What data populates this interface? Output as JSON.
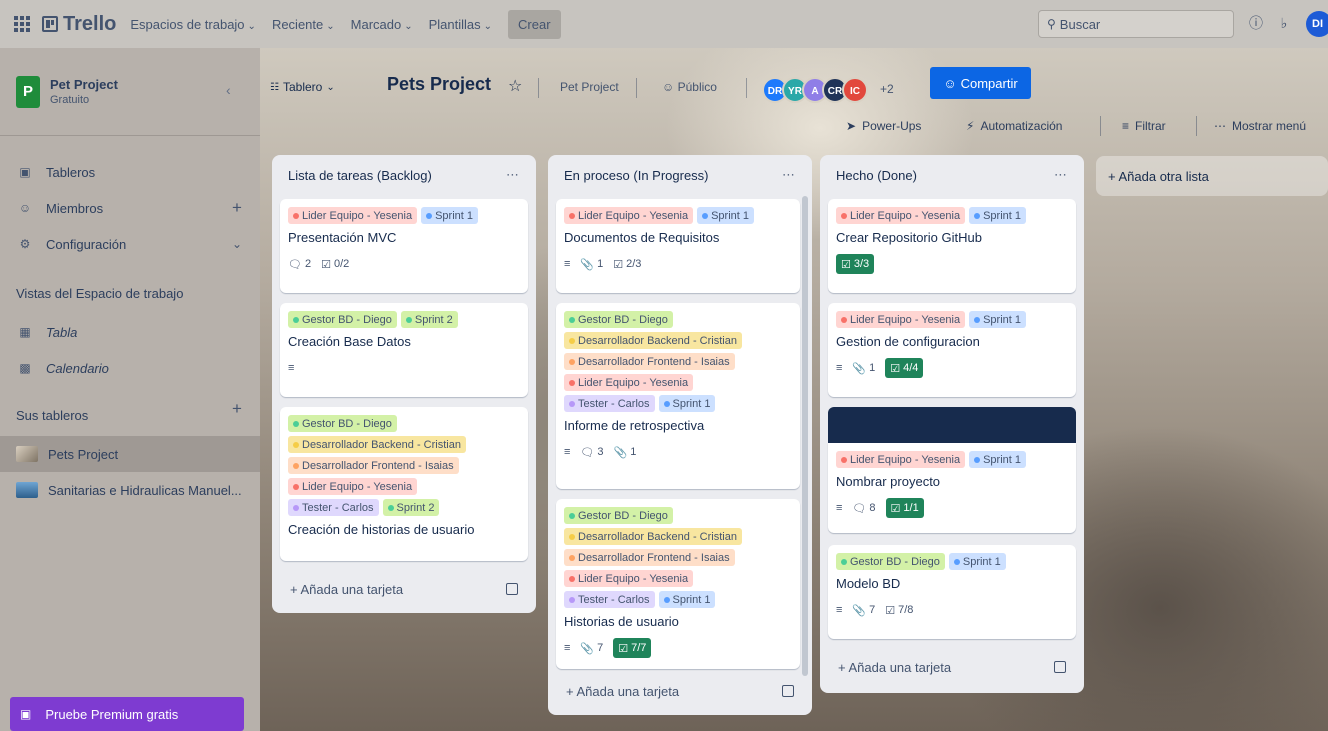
{
  "topbar": {
    "logo": "Trello",
    "nav": [
      {
        "label": "Espacios de trabajo"
      },
      {
        "label": "Reciente"
      },
      {
        "label": "Marcado"
      },
      {
        "label": "Plantillas"
      }
    ],
    "create_label": "Crear",
    "search_placeholder": "Buscar",
    "user_initials": "DI"
  },
  "sidebar": {
    "workspace_initial": "P",
    "workspace_name": "Pet Project",
    "workspace_plan": "Gratuito",
    "items": [
      {
        "label": "Tableros",
        "icon": "board-icon"
      },
      {
        "label": "Miembros",
        "icon": "person-icon"
      },
      {
        "label": "Configuración",
        "icon": "gear-icon"
      }
    ],
    "views_heading": "Vistas del Espacio de trabajo",
    "views": [
      {
        "label": "Tabla",
        "icon": "table-icon"
      },
      {
        "label": "Calendario",
        "icon": "calendar-icon"
      }
    ],
    "boards_heading": "Sus tableros",
    "boards": [
      {
        "label": "Pets Project"
      },
      {
        "label": "Sanitarias e Hidraulicas Manuel..."
      }
    ],
    "premium_label": "Pruebe Premium gratis"
  },
  "board": {
    "view_label": "Tablero",
    "title": "Pets Project",
    "workspace_label": "Pet Project",
    "visibility_label": "Público",
    "members": [
      "DR",
      "YR",
      "A",
      "CR",
      "IC"
    ],
    "members_more": "+2",
    "share_label": "Compartir",
    "powerups_label": "Power-Ups",
    "automation_label": "Automatización",
    "filter_label": "Filtrar",
    "menu_label": "Mostrar menú",
    "add_list_label": "+ Añada otra lista",
    "add_card_label": "+ Añada una tarjeta"
  },
  "lists": [
    {
      "title": "Lista de tareas (Backlog)",
      "cards": [
        {
          "labels": [
            {
              "text": "Lider Equipo - Yesenia",
              "color": "red"
            },
            {
              "text": "Sprint 1",
              "color": "blue"
            }
          ],
          "title": "Presentación MVC",
          "comments": "2",
          "checklist": "0/2"
        },
        {
          "labels": [
            {
              "text": "Gestor BD - Diego",
              "color": "green"
            },
            {
              "text": "Sprint 2",
              "color": "green"
            }
          ],
          "title": "Creación Base Datos"
        },
        {
          "labels": [
            {
              "text": "Gestor BD - Diego",
              "color": "green"
            },
            {
              "text": "Desarrollador Backend - Cristian",
              "color": "yellow"
            },
            {
              "text": "Desarrollador Frontend - Isaias",
              "color": "orange"
            },
            {
              "text": "Lider Equipo - Yesenia",
              "color": "red"
            },
            {
              "text": "Tester - Carlos",
              "color": "purple"
            },
            {
              "text": "Sprint 2",
              "color": "green"
            }
          ],
          "title": "Creación de historias de usuario"
        }
      ]
    },
    {
      "title": "En proceso (In Progress)",
      "cards": [
        {
          "labels": [
            {
              "text": "Lider Equipo - Yesenia",
              "color": "red"
            },
            {
              "text": "Sprint 1",
              "color": "blue"
            }
          ],
          "title": "Documentos de Requisitos",
          "attachments": "1",
          "checklist": "2/3"
        },
        {
          "labels": [
            {
              "text": "Gestor BD - Diego",
              "color": "green"
            },
            {
              "text": "Desarrollador Backend - Cristian",
              "color": "yellow"
            },
            {
              "text": "Desarrollador Frontend - Isaias",
              "color": "orange"
            },
            {
              "text": "Lider Equipo - Yesenia",
              "color": "red"
            },
            {
              "text": "Tester - Carlos",
              "color": "purple"
            },
            {
              "text": "Sprint 1",
              "color": "blue"
            }
          ],
          "title": "Informe de retrospectiva",
          "comments": "3",
          "attachments": "1"
        },
        {
          "labels": [
            {
              "text": "Gestor BD - Diego",
              "color": "green"
            },
            {
              "text": "Desarrollador Backend - Cristian",
              "color": "yellow"
            },
            {
              "text": "Desarrollador Frontend - Isaias",
              "color": "orange"
            },
            {
              "text": "Lider Equipo - Yesenia",
              "color": "red"
            },
            {
              "text": "Tester - Carlos",
              "color": "purple"
            },
            {
              "text": "Sprint 1",
              "color": "blue"
            }
          ],
          "title": "Historias de usuario",
          "attachments": "7",
          "checklist": "7/7"
        }
      ]
    },
    {
      "title": "Hecho (Done)",
      "cards": [
        {
          "labels": [
            {
              "text": "Lider Equipo - Yesenia",
              "color": "red"
            },
            {
              "text": "Sprint 1",
              "color": "blue"
            }
          ],
          "title": "Crear Repositorio GitHub",
          "checklist": "3/3"
        },
        {
          "labels": [
            {
              "text": "Lider Equipo - Yesenia",
              "color": "red"
            },
            {
              "text": "Sprint 1",
              "color": "blue"
            }
          ],
          "title": "Gestion de configuracion",
          "attachments": "1",
          "checklist": "4/4"
        },
        {
          "labels": [
            {
              "text": "Lider Equipo - Yesenia",
              "color": "red"
            },
            {
              "text": "Sprint 1",
              "color": "blue"
            }
          ],
          "title": "Nombrar proyecto",
          "comments": "8",
          "checklist": "1/1"
        },
        {
          "labels": [
            {
              "text": "Gestor BD - Diego",
              "color": "green"
            },
            {
              "text": "Sprint 1",
              "color": "blue"
            }
          ],
          "title": "Modelo BD",
          "attachments": "7",
          "checklist": "7/8"
        }
      ]
    }
  ],
  "colors": {
    "accent": "#0c66e4",
    "premium": "#7e3bd1",
    "done_badge": "#1f845a",
    "cover": "#172b4d"
  }
}
